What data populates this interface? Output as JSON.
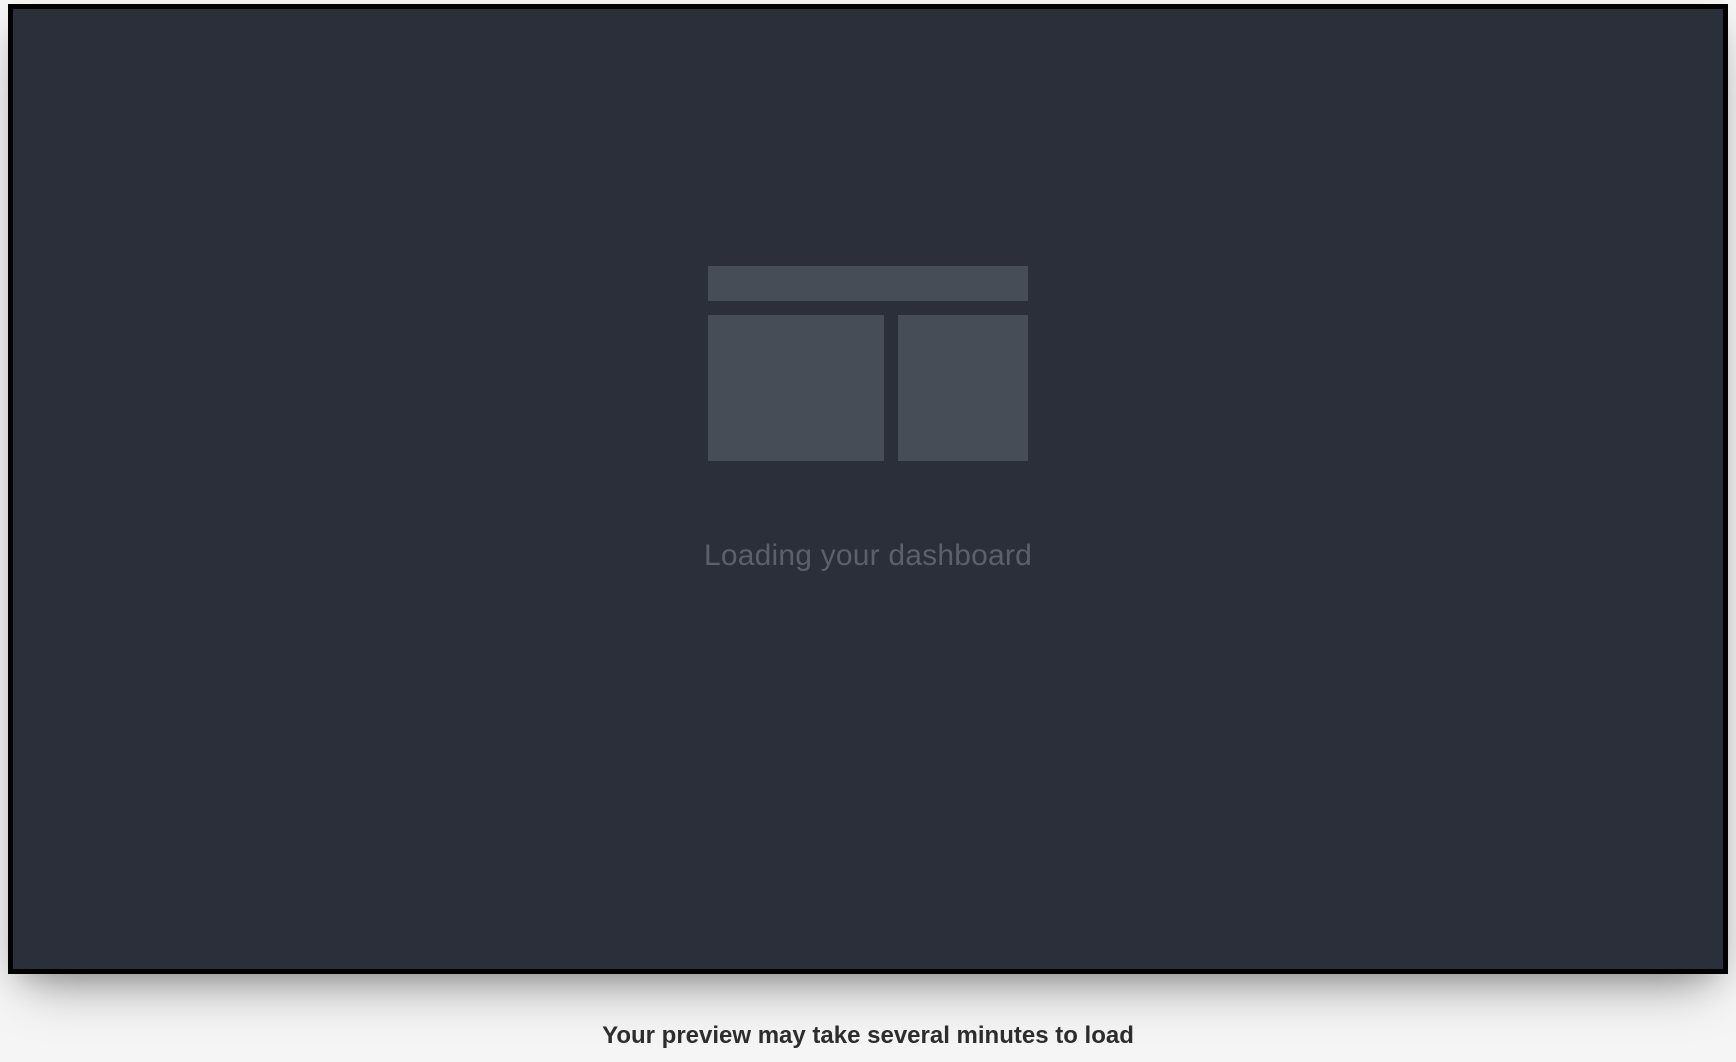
{
  "preview": {
    "loading_text": "Loading your dashboard"
  },
  "footer": {
    "note": "Your preview may take several minutes to load"
  }
}
